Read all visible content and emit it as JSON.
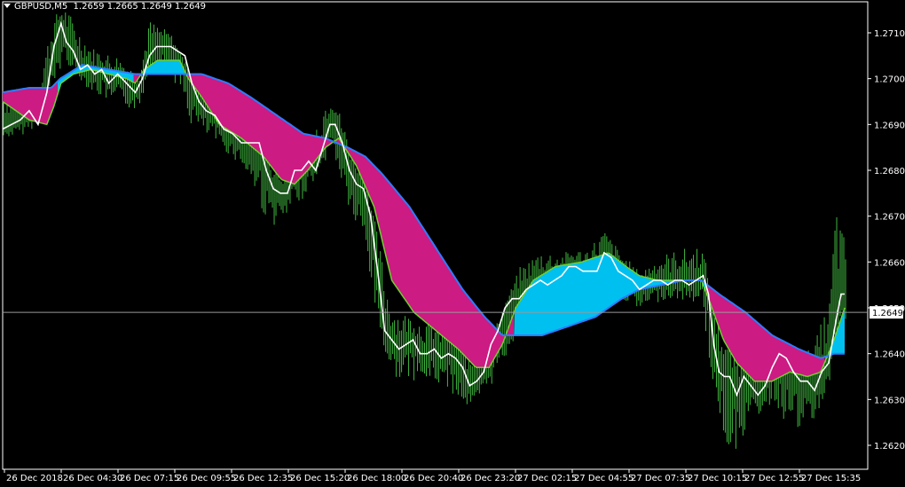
{
  "header": {
    "symbol_tf": "GBPUSD,M5",
    "ohlc": "1.2659 1.2665 1.2649 1.2649"
  },
  "colors": {
    "background": "#000000",
    "axis": "#ffffff",
    "bar": "#3fb63f",
    "price_line": "#ffffff",
    "band_fast": "#2f7cff",
    "band_slow": "#2f7cff",
    "bull_fill": "#00c0f0",
    "bear_fill": "#cc1b82",
    "bull_edge": "#6fd030",
    "current_price_bg": "#ffffff",
    "current_price_text": "#000000"
  },
  "chart_data": {
    "type": "candlestick",
    "symbol": "GBPUSD",
    "timeframe": "M5",
    "ylim": [
      1.2615,
      1.2718
    ],
    "yticks": [
      "1.2710",
      "1.2700",
      "1.2690",
      "1.2680",
      "1.2670",
      "1.2660",
      "1.2650",
      "1.2640",
      "1.2630",
      "1.2620"
    ],
    "current_price": "1.2649",
    "xticks": [
      "26 Dec 2018",
      "26 Dec 04:30",
      "26 Dec 07:15",
      "26 Dec 09:55",
      "26 Dec 12:35",
      "26 Dec 15:20",
      "26 Dec 18:00",
      "26 Dec 20:40",
      "26 Dec 23:20",
      "27 Dec 02:15",
      "27 Dec 04:55",
      "27 Dec 07:35",
      "27 Dec 10:15",
      "27 Dec 12:55",
      "27 Dec 15:35"
    ],
    "bars": 479,
    "close_path": [
      [
        0,
        1.2689
      ],
      [
        10,
        1.269
      ],
      [
        20,
        1.2691
      ],
      [
        30,
        1.2693
      ],
      [
        40,
        1.269
      ],
      [
        50,
        1.2697
      ],
      [
        58,
        1.2707
      ],
      [
        66,
        1.2712
      ],
      [
        72,
        1.2708
      ],
      [
        80,
        1.2706
      ],
      [
        88,
        1.2702
      ],
      [
        96,
        1.2703
      ],
      [
        104,
        1.2701
      ],
      [
        112,
        1.2702
      ],
      [
        120,
        1.2699
      ],
      [
        130,
        1.2701
      ],
      [
        140,
        1.2699
      ],
      [
        150,
        1.2697
      ],
      [
        158,
        1.27
      ],
      [
        166,
        1.2705
      ],
      [
        174,
        1.2707
      ],
      [
        182,
        1.2707
      ],
      [
        190,
        1.2707
      ],
      [
        198,
        1.2706
      ],
      [
        206,
        1.2705
      ],
      [
        214,
        1.2699
      ],
      [
        222,
        1.2695
      ],
      [
        230,
        1.2693
      ],
      [
        240,
        1.2692
      ],
      [
        250,
        1.2689
      ],
      [
        260,
        1.2688
      ],
      [
        270,
        1.2686
      ],
      [
        280,
        1.2686
      ],
      [
        290,
        1.2686
      ],
      [
        298,
        1.268
      ],
      [
        306,
        1.2676
      ],
      [
        314,
        1.2675
      ],
      [
        322,
        1.2675
      ],
      [
        330,
        1.268
      ],
      [
        338,
        1.268
      ],
      [
        346,
        1.2682
      ],
      [
        354,
        1.268
      ],
      [
        362,
        1.2685
      ],
      [
        370,
        1.269
      ],
      [
        376,
        1.269
      ],
      [
        384,
        1.2686
      ],
      [
        392,
        1.268
      ],
      [
        400,
        1.2677
      ],
      [
        408,
        1.2676
      ],
      [
        416,
        1.267
      ],
      [
        424,
        1.2658
      ],
      [
        432,
        1.2645
      ],
      [
        440,
        1.2643
      ],
      [
        448,
        1.2641
      ],
      [
        456,
        1.2642
      ],
      [
        464,
        1.2643
      ],
      [
        472,
        1.264
      ],
      [
        480,
        1.264
      ],
      [
        488,
        1.2641
      ],
      [
        496,
        1.2639
      ],
      [
        504,
        1.264
      ],
      [
        512,
        1.2639
      ],
      [
        520,
        1.2637
      ],
      [
        528,
        1.2633
      ],
      [
        536,
        1.2634
      ],
      [
        544,
        1.2636
      ],
      [
        552,
        1.2642
      ],
      [
        560,
        1.2645
      ],
      [
        568,
        1.265
      ],
      [
        576,
        1.2652
      ],
      [
        584,
        1.2652
      ],
      [
        592,
        1.2654
      ],
      [
        600,
        1.2655
      ],
      [
        608,
        1.2656
      ],
      [
        616,
        1.2655
      ],
      [
        624,
        1.2656
      ],
      [
        632,
        1.2657
      ],
      [
        640,
        1.2659
      ],
      [
        648,
        1.2659
      ],
      [
        656,
        1.2658
      ],
      [
        664,
        1.2658
      ],
      [
        672,
        1.2658
      ],
      [
        680,
        1.2662
      ],
      [
        688,
        1.2661
      ],
      [
        696,
        1.2658
      ],
      [
        704,
        1.2657
      ],
      [
        712,
        1.2656
      ],
      [
        720,
        1.2654
      ],
      [
        728,
        1.2655
      ],
      [
        736,
        1.2656
      ],
      [
        744,
        1.2656
      ],
      [
        752,
        1.2655
      ],
      [
        760,
        1.2656
      ],
      [
        768,
        1.2656
      ],
      [
        776,
        1.2655
      ],
      [
        784,
        1.2656
      ],
      [
        792,
        1.2657
      ],
      [
        798,
        1.2653
      ],
      [
        804,
        1.2642
      ],
      [
        810,
        1.2636
      ],
      [
        816,
        1.2635
      ],
      [
        822,
        1.2635
      ],
      [
        830,
        1.2631
      ],
      [
        838,
        1.2635
      ],
      [
        846,
        1.2633
      ],
      [
        854,
        1.2631
      ],
      [
        862,
        1.2633
      ],
      [
        870,
        1.2637
      ],
      [
        878,
        1.264
      ],
      [
        886,
        1.2639
      ],
      [
        894,
        1.2636
      ],
      [
        902,
        1.2634
      ],
      [
        910,
        1.2634
      ],
      [
        918,
        1.2632
      ],
      [
        926,
        1.2636
      ],
      [
        934,
        1.2638
      ],
      [
        942,
        1.2647
      ],
      [
        948,
        1.2653
      ],
      [
        952,
        1.2653
      ]
    ],
    "upper_band": [
      [
        0,
        1.2697
      ],
      [
        30,
        1.2698
      ],
      [
        55,
        1.2698
      ],
      [
        65,
        1.27
      ],
      [
        90,
        1.2703
      ],
      [
        120,
        1.2702
      ],
      [
        150,
        1.2701
      ],
      [
        170,
        1.2701
      ],
      [
        205,
        1.2701
      ],
      [
        225,
        1.2701
      ],
      [
        255,
        1.2699
      ],
      [
        280,
        1.2696
      ],
      [
        310,
        1.2692
      ],
      [
        340,
        1.2688
      ],
      [
        365,
        1.2687
      ],
      [
        390,
        1.2685
      ],
      [
        410,
        1.2683
      ],
      [
        430,
        1.2679
      ],
      [
        460,
        1.2672
      ],
      [
        490,
        1.2663
      ],
      [
        520,
        1.2654
      ],
      [
        545,
        1.2648
      ],
      [
        565,
        1.2644
      ],
      [
        580,
        1.2644
      ],
      [
        610,
        1.2644
      ],
      [
        640,
        1.2646
      ],
      [
        670,
        1.2648
      ],
      [
        700,
        1.2652
      ],
      [
        720,
        1.2654
      ],
      [
        745,
        1.2655
      ],
      [
        770,
        1.2656
      ],
      [
        790,
        1.2656
      ],
      [
        810,
        1.2653
      ],
      [
        840,
        1.2649
      ],
      [
        870,
        1.2644
      ],
      [
        900,
        1.2641
      ],
      [
        925,
        1.2639
      ],
      [
        940,
        1.264
      ],
      [
        952,
        1.264
      ]
    ],
    "lower_band": [
      [
        0,
        1.2695
      ],
      [
        15,
        1.2693
      ],
      [
        30,
        1.2691
      ],
      [
        50,
        1.269
      ],
      [
        58,
        1.2694
      ],
      [
        66,
        1.2699
      ],
      [
        80,
        1.2701
      ],
      [
        100,
        1.2702
      ],
      [
        120,
        1.2701
      ],
      [
        140,
        1.27
      ],
      [
        150,
        1.2699
      ],
      [
        160,
        1.2702
      ],
      [
        175,
        1.2704
      ],
      [
        200,
        1.2704
      ],
      [
        210,
        1.27
      ],
      [
        225,
        1.2696
      ],
      [
        245,
        1.269
      ],
      [
        270,
        1.2687
      ],
      [
        295,
        1.2683
      ],
      [
        315,
        1.2678
      ],
      [
        330,
        1.2677
      ],
      [
        345,
        1.268
      ],
      [
        365,
        1.2685
      ],
      [
        380,
        1.2687
      ],
      [
        400,
        1.2681
      ],
      [
        420,
        1.2672
      ],
      [
        440,
        1.2656
      ],
      [
        465,
        1.2649
      ],
      [
        490,
        1.2645
      ],
      [
        515,
        1.2641
      ],
      [
        535,
        1.2637
      ],
      [
        550,
        1.2637
      ],
      [
        565,
        1.2642
      ],
      [
        580,
        1.265
      ],
      [
        600,
        1.2656
      ],
      [
        625,
        1.2659
      ],
      [
        655,
        1.266
      ],
      [
        685,
        1.2662
      ],
      [
        705,
        1.2659
      ],
      [
        720,
        1.2657
      ],
      [
        740,
        1.2656
      ],
      [
        765,
        1.2656
      ],
      [
        790,
        1.2656
      ],
      [
        800,
        1.2651
      ],
      [
        815,
        1.2643
      ],
      [
        830,
        1.2638
      ],
      [
        850,
        1.2634
      ],
      [
        870,
        1.2634
      ],
      [
        890,
        1.2636
      ],
      [
        910,
        1.2635
      ],
      [
        925,
        1.2636
      ],
      [
        940,
        1.2643
      ],
      [
        952,
        1.265
      ]
    ],
    "regime": [
      {
        "from": 0,
        "to": 62,
        "trend": "bear"
      },
      {
        "from": 62,
        "to": 148,
        "trend": "bull"
      },
      {
        "from": 148,
        "to": 158,
        "trend": "bear"
      },
      {
        "from": 158,
        "to": 208,
        "trend": "bull"
      },
      {
        "from": 208,
        "to": 578,
        "trend": "bear"
      },
      {
        "from": 578,
        "to": 795,
        "trend": "bull"
      },
      {
        "from": 795,
        "to": 930,
        "trend": "bear"
      },
      {
        "from": 930,
        "to": 952,
        "trend": "bull"
      }
    ],
    "range_ticks": [
      [
        0,
        1.2698,
        1.2687
      ],
      [
        30,
        1.2697,
        1.2688
      ],
      [
        60,
        1.2714,
        1.2698
      ],
      [
        70,
        1.2716,
        1.2704
      ],
      [
        100,
        1.2707,
        1.2697
      ],
      [
        130,
        1.2705,
        1.2694
      ],
      [
        155,
        1.2701,
        1.2693
      ],
      [
        165,
        1.2713,
        1.2702
      ],
      [
        190,
        1.271,
        1.2702
      ],
      [
        210,
        1.2701,
        1.269
      ],
      [
        240,
        1.2697,
        1.2686
      ],
      [
        270,
        1.2691,
        1.2681
      ],
      [
        300,
        1.2684,
        1.2668
      ],
      [
        315,
        1.2679,
        1.2668
      ],
      [
        340,
        1.2684,
        1.2674
      ],
      [
        365,
        1.2696,
        1.2682
      ],
      [
        372,
        1.2699,
        1.2685
      ],
      [
        385,
        1.269,
        1.2675
      ],
      [
        410,
        1.268,
        1.2661
      ],
      [
        425,
        1.2665,
        1.2645
      ],
      [
        440,
        1.265,
        1.2635
      ],
      [
        470,
        1.2648,
        1.2634
      ],
      [
        500,
        1.2646,
        1.2633
      ],
      [
        530,
        1.264,
        1.2627
      ],
      [
        560,
        1.2647,
        1.2635
      ],
      [
        585,
        1.2659,
        1.2645
      ],
      [
        610,
        1.2663,
        1.265
      ],
      [
        630,
        1.2662,
        1.2651
      ],
      [
        660,
        1.2663,
        1.2653
      ],
      [
        680,
        1.2667,
        1.2655
      ],
      [
        700,
        1.2662,
        1.2652
      ],
      [
        720,
        1.2658,
        1.2649
      ],
      [
        750,
        1.2662,
        1.2652
      ],
      [
        790,
        1.2664,
        1.2651
      ],
      [
        805,
        1.2652,
        1.263
      ],
      [
        815,
        1.2645,
        1.2622
      ],
      [
        825,
        1.2641,
        1.2617
      ],
      [
        845,
        1.264,
        1.2625
      ],
      [
        870,
        1.2645,
        1.2629
      ],
      [
        895,
        1.2641,
        1.2622
      ],
      [
        915,
        1.2641,
        1.2624
      ],
      [
        935,
        1.2652,
        1.2633
      ],
      [
        942,
        1.2675,
        1.2643
      ],
      [
        950,
        1.2666,
        1.2645
      ]
    ]
  }
}
